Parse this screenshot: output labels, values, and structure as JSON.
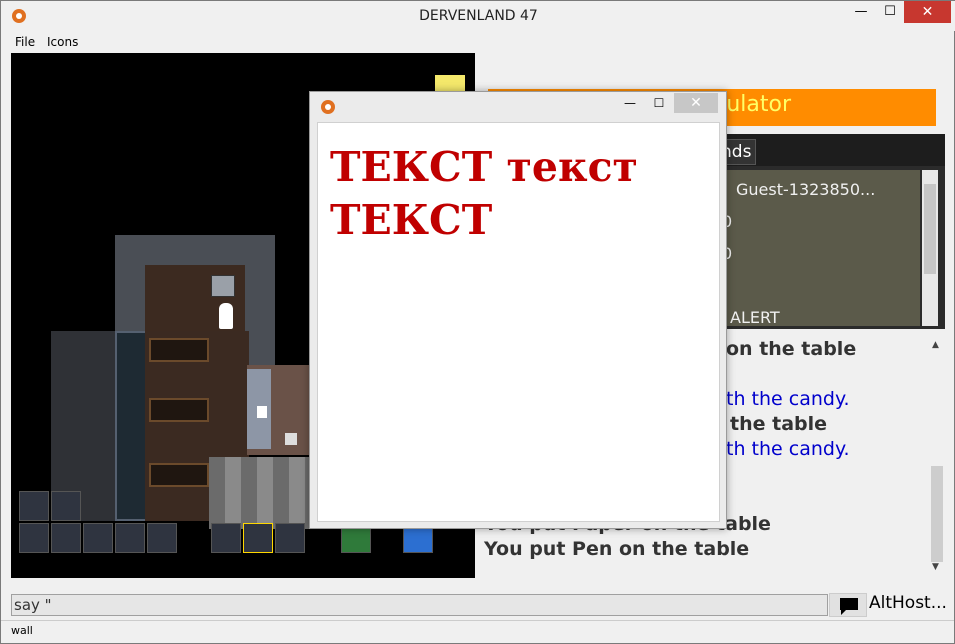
{
  "window": {
    "title": "DERVENLAND 47",
    "min_label": "—",
    "max_label": "☐",
    "close_label": "✕"
  },
  "menu": {
    "file_label": "File",
    "icons_label": "Icons"
  },
  "right": {
    "banner_text": "ulator",
    "tab_label": "nds",
    "info_lines": [
      "Guest-1323850...",
      "0",
      "0",
      "ALERT"
    ],
    "chat_lines": [
      "on the table",
      "th the candy.",
      "the table",
      "th the candy.",
      "You put Paper on the table",
      "You put Pen on the table"
    ]
  },
  "popup": {
    "min_label": "—",
    "max_label": "☐",
    "close_label": "✕",
    "text": "ТЕКСТ текст ТЕКСТ"
  },
  "input": {
    "value": "say \"",
    "alt_label": "AltHost..."
  },
  "status": {
    "text": "wall"
  },
  "colors": {
    "banner": "#ff8c00",
    "popup_text": "#c00000",
    "chat_blue": "#0000cc"
  }
}
